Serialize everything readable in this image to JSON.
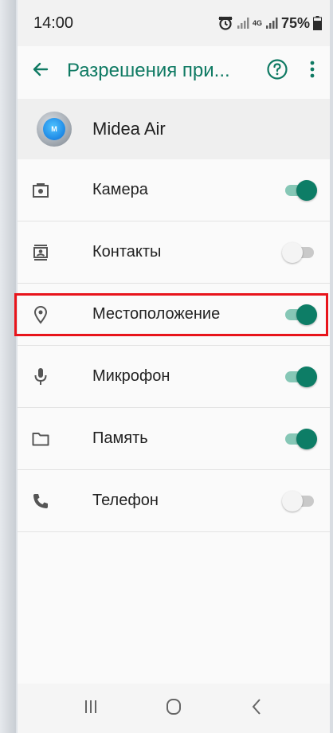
{
  "status_bar": {
    "time": "14:00",
    "network_label": "4G",
    "battery": "75%",
    "icons": [
      "alarm-icon",
      "signal-icon",
      "signal-icon",
      "battery-icon"
    ]
  },
  "app_bar": {
    "title": "Разрешения при...",
    "back_icon": "arrow-left-icon",
    "help_icon": "help-circle-icon",
    "more_icon": "more-vert-icon"
  },
  "app": {
    "name": "Midea Air",
    "icon_text": "M"
  },
  "permissions": [
    {
      "label": "Камера",
      "icon": "camera-icon",
      "enabled": true
    },
    {
      "label": "Контакты",
      "icon": "contacts-icon",
      "enabled": false
    },
    {
      "label": "Местоположение",
      "icon": "location-icon",
      "enabled": true
    },
    {
      "label": "Микрофон",
      "icon": "microphone-icon",
      "enabled": true
    },
    {
      "label": "Память",
      "icon": "folder-icon",
      "enabled": true
    },
    {
      "label": "Телефон",
      "icon": "phone-icon",
      "enabled": false
    }
  ],
  "nav_bar": {
    "icons": [
      "recent-apps-icon",
      "home-icon",
      "back-icon"
    ]
  },
  "colors": {
    "accent": "#0f7a63",
    "toggle_on": "#0d7d66",
    "highlight": "#e8141b"
  }
}
